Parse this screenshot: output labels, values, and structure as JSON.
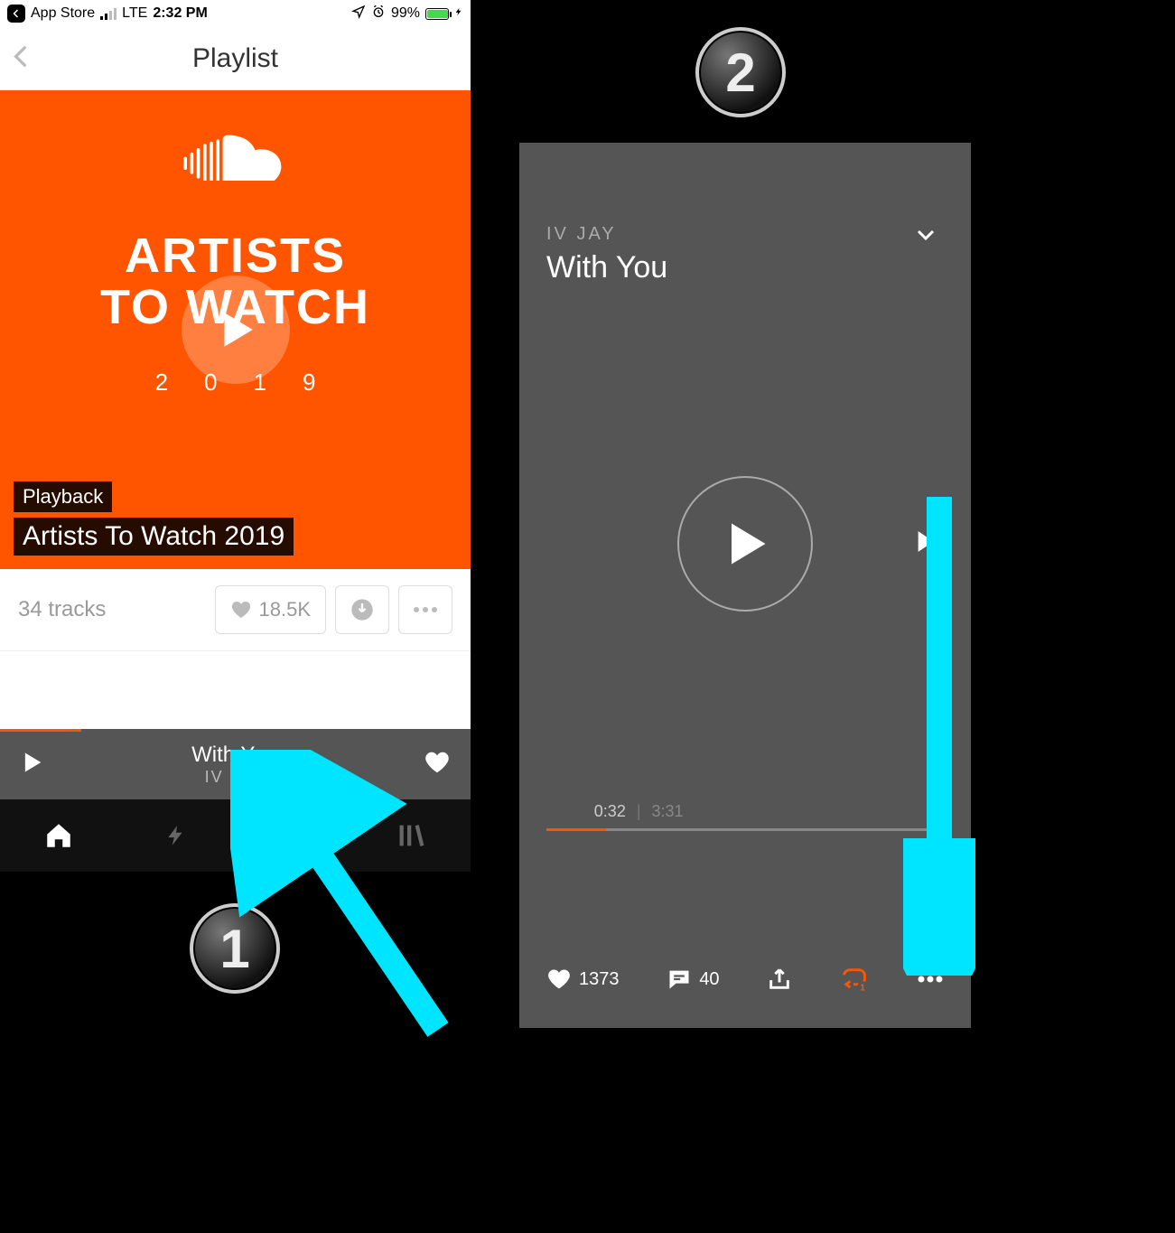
{
  "statusbar": {
    "back_app": "App Store",
    "carrier": "LTE",
    "time": "2:32 PM",
    "battery_pct": "99%"
  },
  "navbar": {
    "title": "Playlist"
  },
  "hero": {
    "line1": "ARTISTS",
    "line2": "TO WATCH",
    "year": "2019",
    "label_small": "Playback",
    "label_big": "Artists To Watch 2019"
  },
  "meta": {
    "tracks": "34 tracks",
    "likes": "18.5K"
  },
  "miniplayer": {
    "title": "With You",
    "artist": "IV JAY"
  },
  "player2": {
    "artist": "IV JAY",
    "title": "With You",
    "elapsed": "0:32",
    "duration": "3:31",
    "likes": "1373",
    "comments": "40"
  },
  "badges": {
    "one": "1",
    "two": "2"
  },
  "colors": {
    "accent": "#ff5500",
    "cyan": "#00e5ff"
  }
}
